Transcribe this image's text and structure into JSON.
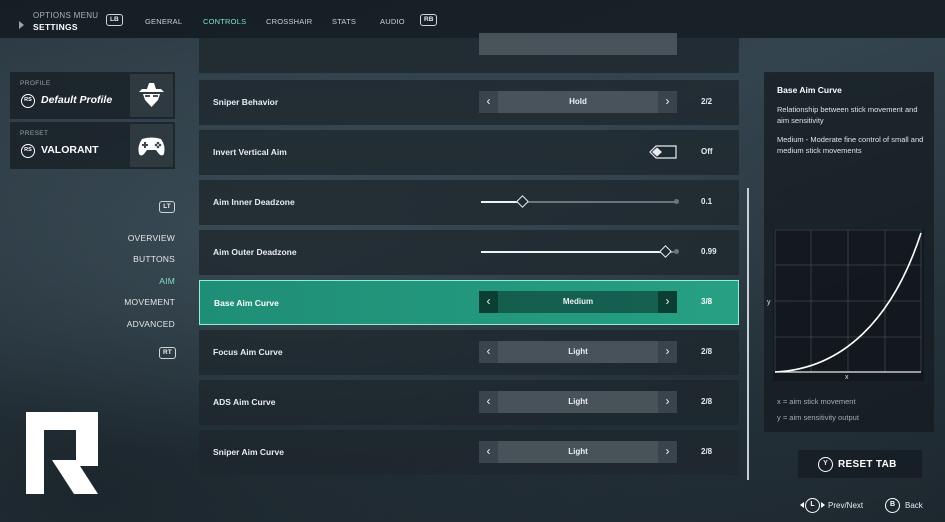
{
  "header": {
    "breadcrumb_top": "OPTIONS MENU",
    "breadcrumb_main": "SETTINGS",
    "lb": "LB",
    "rb": "RB",
    "tabs": [
      "GENERAL",
      "CONTROLS",
      "CROSSHAIR",
      "STATS",
      "AUDIO"
    ],
    "active_tab": "CONTROLS"
  },
  "profile": {
    "caption": "PROFILE",
    "name": "Default Profile",
    "badge": "RS"
  },
  "preset": {
    "caption": "PRESET",
    "name": "VALORANT",
    "badge": "RS"
  },
  "nav": {
    "lt": "LT",
    "rt": "RT",
    "items": [
      "OVERVIEW",
      "BUTTONS",
      "AIM",
      "MOVEMENT",
      "ADVANCED"
    ],
    "active": "AIM"
  },
  "rows": [
    {
      "label": "Sniper Behavior",
      "control": "cycler",
      "value": "Hold",
      "count": "2/2"
    },
    {
      "label": "Invert Vertical Aim",
      "control": "toggle",
      "count": "Off"
    },
    {
      "label": "Aim Inner Deadzone",
      "control": "slider",
      "level": 0.21,
      "count": "0.1"
    },
    {
      "label": "Aim Outer Deadzone",
      "control": "slider",
      "level": 0.94,
      "count": "0.99"
    },
    {
      "label": "Base Aim Curve",
      "control": "cycler",
      "value": "Medium",
      "count": "3/8",
      "selected": true
    },
    {
      "label": "Focus Aim Curve",
      "control": "cycler",
      "value": "Light",
      "count": "2/8"
    },
    {
      "label": "ADS Aim Curve",
      "control": "cycler",
      "value": "Light",
      "count": "2/8"
    },
    {
      "label": "Sniper Aim Curve",
      "control": "cycler",
      "value": "Light",
      "count": "2/8"
    }
  ],
  "info": {
    "title": "Base Aim Curve",
    "description": "Relationship between stick movement and aim sensitivity",
    "detail": "Medium - Moderate fine control of small and medium stick movements",
    "axis_x": "x",
    "axis_y": "y",
    "note_x": "x = aim stick movement",
    "note_y": "y = aim sensitivity output"
  },
  "footer": {
    "reset_key": "Y",
    "reset_label": "RESET TAB",
    "prev_next_key": "L",
    "prev_next_label": "Prev/Next",
    "back_key": "B",
    "back_label": "Back"
  },
  "colors": {
    "accent": "#7fe0c6",
    "selected_row": "#23977c"
  }
}
